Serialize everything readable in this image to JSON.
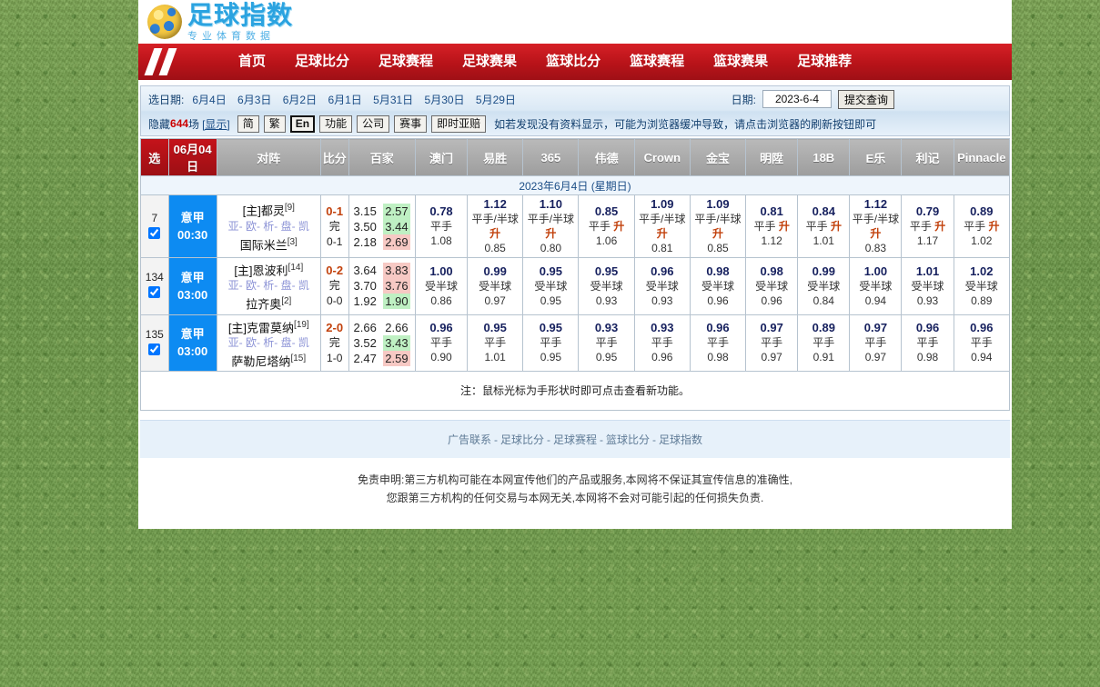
{
  "logo": {
    "main": "足球指数",
    "sub": "专业体育数据"
  },
  "nav": [
    {
      "label": "首页"
    },
    {
      "label": "足球比分"
    },
    {
      "label": "足球赛程"
    },
    {
      "label": "足球赛果"
    },
    {
      "label": "篮球比分"
    },
    {
      "label": "篮球赛程"
    },
    {
      "label": "篮球赛果"
    },
    {
      "label": "足球推荐"
    }
  ],
  "toolbar": {
    "date_label": "选日期:",
    "date_links": [
      "6月4日",
      "6月3日",
      "6月2日",
      "6月1日",
      "5月31日",
      "5月30日",
      "5月29日"
    ],
    "date_field_label": "日期:",
    "date_value": "2023-6-4",
    "submit_label": "提交查询",
    "hidden_prefix": "隐藏",
    "hidden_count": "644",
    "hidden_suffix": "场",
    "show_label": "[显示]",
    "buttons": [
      "简",
      "繁",
      "En",
      "功能",
      "公司",
      "赛事",
      "即时亚赔"
    ],
    "active_button": "En",
    "tip": "如若发现没有资料显示，可能为浏览器缓冲导致，请点击浏览器的刷新按钮即可"
  },
  "table": {
    "headers": [
      "选",
      "06月04日",
      "对阵",
      "比分",
      "百家",
      "澳门",
      "易胜",
      "365",
      "伟德",
      "Crown",
      "金宝",
      "明陞",
      "18B",
      "E乐",
      "利记",
      "Pinnacle"
    ],
    "date_row": "2023年6月4日 (星期日)",
    "rows": [
      {
        "num": "7",
        "league": "意甲",
        "time": "00:30",
        "home": "[主]都灵",
        "home_rank": "[9]",
        "away": "国际米兰",
        "away_rank": "[3]",
        "links": "亚- 欧- 析- 盘- 凯",
        "score_final": "0-1",
        "score_state": "完",
        "score_half": "0-1",
        "eur": [
          {
            "open": "3.15",
            "now": "2.57",
            "trend": "up"
          },
          {
            "open": "3.50",
            "now": "3.44",
            "trend": "up"
          },
          {
            "open": "2.18",
            "now": "2.69",
            "trend": "down"
          }
        ],
        "odds": [
          {
            "top": "0.78",
            "hcp": "平手",
            "rise": "",
            "bot": "1.08"
          },
          {
            "top": "1.12",
            "hcp": "平手/半球",
            "rise": "升",
            "bot": "0.85"
          },
          {
            "top": "1.10",
            "hcp": "平手/半球",
            "rise": "升",
            "bot": "0.80"
          },
          {
            "top": "0.85",
            "hcp": "平手",
            "rise": "升",
            "bot": "1.06"
          },
          {
            "top": "1.09",
            "hcp": "平手/半球",
            "rise": "升",
            "bot": "0.81"
          },
          {
            "top": "1.09",
            "hcp": "平手/半球",
            "rise": "升",
            "bot": "0.85"
          },
          {
            "top": "0.81",
            "hcp": "平手",
            "rise": "升",
            "bot": "1.12"
          },
          {
            "top": "0.84",
            "hcp": "平手",
            "rise": "升",
            "bot": "1.01"
          },
          {
            "top": "1.12",
            "hcp": "平手/半球",
            "rise": "升",
            "bot": "0.83"
          },
          {
            "top": "0.79",
            "hcp": "平手",
            "rise": "升",
            "bot": "1.17"
          },
          {
            "top": "0.89",
            "hcp": "平手",
            "rise": "升",
            "bot": "1.02"
          }
        ]
      },
      {
        "num": "134",
        "league": "意甲",
        "time": "03:00",
        "home": "[主]恩波利",
        "home_rank": "[14]",
        "away": "拉齐奥",
        "away_rank": "[2]",
        "links": "亚- 欧- 析- 盘- 凯",
        "score_final": "0-2",
        "score_state": "完",
        "score_half": "0-0",
        "eur": [
          {
            "open": "3.64",
            "now": "3.83",
            "trend": "down"
          },
          {
            "open": "3.70",
            "now": "3.76",
            "trend": "down"
          },
          {
            "open": "1.92",
            "now": "1.90",
            "trend": "up"
          }
        ],
        "odds": [
          {
            "top": "1.00",
            "hcp": "受半球",
            "rise": "",
            "bot": "0.86"
          },
          {
            "top": "0.99",
            "hcp": "受半球",
            "rise": "",
            "bot": "0.97"
          },
          {
            "top": "0.95",
            "hcp": "受半球",
            "rise": "",
            "bot": "0.95"
          },
          {
            "top": "0.95",
            "hcp": "受半球",
            "rise": "",
            "bot": "0.93"
          },
          {
            "top": "0.96",
            "hcp": "受半球",
            "rise": "",
            "bot": "0.93"
          },
          {
            "top": "0.98",
            "hcp": "受半球",
            "rise": "",
            "bot": "0.96"
          },
          {
            "top": "0.98",
            "hcp": "受半球",
            "rise": "",
            "bot": "0.96"
          },
          {
            "top": "0.99",
            "hcp": "受半球",
            "rise": "",
            "bot": "0.84"
          },
          {
            "top": "1.00",
            "hcp": "受半球",
            "rise": "",
            "bot": "0.94"
          },
          {
            "top": "1.01",
            "hcp": "受半球",
            "rise": "",
            "bot": "0.93"
          },
          {
            "top": "1.02",
            "hcp": "受半球",
            "rise": "",
            "bot": "0.89"
          }
        ]
      },
      {
        "num": "135",
        "league": "意甲",
        "time": "03:00",
        "home": "[主]克雷莫纳",
        "home_rank": "[19]",
        "away": "萨勒尼塔纳",
        "away_rank": "[15]",
        "links": "亚- 欧- 析- 盘- 凯",
        "score_final": "2-0",
        "score_state": "完",
        "score_half": "1-0",
        "eur": [
          {
            "open": "2.66",
            "now": "2.66",
            "trend": ""
          },
          {
            "open": "3.52",
            "now": "3.43",
            "trend": "up"
          },
          {
            "open": "2.47",
            "now": "2.59",
            "trend": "down"
          }
        ],
        "odds": [
          {
            "top": "0.96",
            "hcp": "平手",
            "rise": "",
            "bot": "0.90"
          },
          {
            "top": "0.95",
            "hcp": "平手",
            "rise": "",
            "bot": "1.01"
          },
          {
            "top": "0.95",
            "hcp": "平手",
            "rise": "",
            "bot": "0.95"
          },
          {
            "top": "0.93",
            "hcp": "平手",
            "rise": "",
            "bot": "0.95"
          },
          {
            "top": "0.93",
            "hcp": "平手",
            "rise": "",
            "bot": "0.96"
          },
          {
            "top": "0.96",
            "hcp": "平手",
            "rise": "",
            "bot": "0.98"
          },
          {
            "top": "0.97",
            "hcp": "平手",
            "rise": "",
            "bot": "0.97"
          },
          {
            "top": "0.89",
            "hcp": "平手",
            "rise": "",
            "bot": "0.91"
          },
          {
            "top": "0.97",
            "hcp": "平手",
            "rise": "",
            "bot": "0.97"
          },
          {
            "top": "0.96",
            "hcp": "平手",
            "rise": "",
            "bot": "0.98"
          },
          {
            "top": "0.96",
            "hcp": "平手",
            "rise": "",
            "bot": "0.94"
          }
        ]
      }
    ]
  },
  "note": "注：鼠标光标为手形状时即可点击查看新功能。",
  "footer_links": [
    "广告联系",
    "足球比分",
    "足球赛程",
    "篮球比分",
    "足球指数"
  ],
  "disclaimer": [
    "免责申明:第三方机构可能在本网宣传他们的产品或服务,本网将不保证其宣传信息的准确性,",
    "您跟第三方机构的任何交易与本网无关,本网将不会对可能引起的任何损失负责."
  ],
  "colors": {
    "accent_red": "#b81319",
    "league_blue": "#0d8bf2",
    "up": "#bff0c3",
    "down": "#f7c9c4"
  }
}
